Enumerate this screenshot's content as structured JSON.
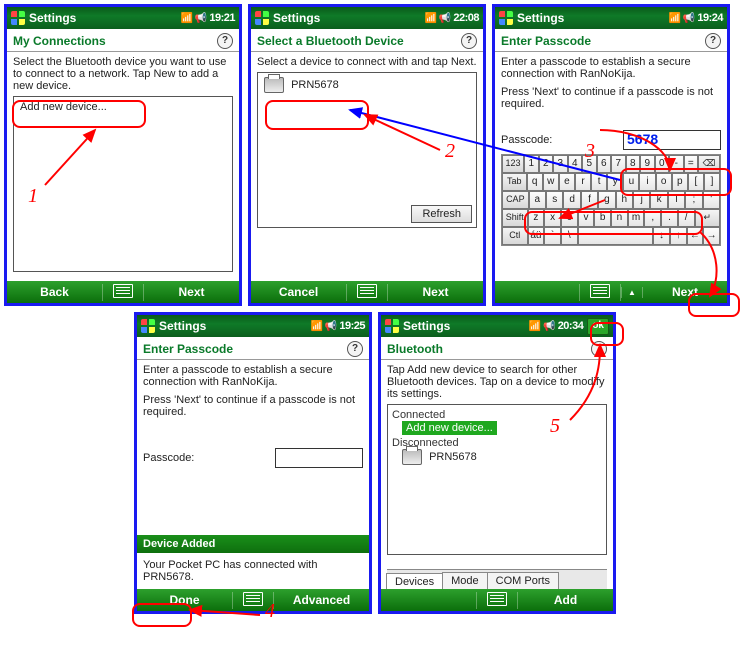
{
  "panel1": {
    "title": "Settings",
    "clock": "19:21",
    "subheader": "My Connections",
    "instructions": "Select the Bluetooth device you want to use to connect to a network. Tap New to add a new device.",
    "add_new": "Add new device...",
    "soft_left": "Back",
    "soft_right": "Next"
  },
  "panel2": {
    "title": "Settings",
    "clock": "22:08",
    "subheader": "Select a Bluetooth Device",
    "instructions": "Select a device to connect with and tap Next.",
    "device": "PRN5678",
    "refresh": "Refresh",
    "soft_left": "Cancel",
    "soft_right": "Next"
  },
  "panel3": {
    "title": "Settings",
    "clock": "19:24",
    "subheader": "Enter Passcode",
    "line1": "Enter a passcode to establish a secure connection with RanNoKija.",
    "line2": "Press 'Next' to continue if a passcode is not required.",
    "label": "Passcode:",
    "value": "5678",
    "soft_right": "Next",
    "sip_rows": [
      [
        "123",
        "1",
        "2",
        "3",
        "4",
        "5",
        "6",
        "7",
        "8",
        "9",
        "0",
        "-",
        "=",
        "⌫"
      ],
      [
        "Tab",
        "q",
        "w",
        "e",
        "r",
        "t",
        "y",
        "u",
        "i",
        "o",
        "p",
        "[",
        "]"
      ],
      [
        "CAP",
        "a",
        "s",
        "d",
        "f",
        "g",
        "h",
        "j",
        "k",
        "l",
        ";",
        "'"
      ],
      [
        "Shift",
        "z",
        "x",
        "c",
        "v",
        "b",
        "n",
        "m",
        ",",
        ".",
        "/",
        "↵"
      ],
      [
        "Ctl",
        "áü",
        "`",
        "\\",
        " ",
        "↓",
        "↑",
        "←",
        "→"
      ]
    ]
  },
  "panel4": {
    "title": "Settings",
    "clock": "19:25",
    "subheader": "Enter Passcode",
    "line1": "Enter a passcode to establish a secure connection with RanNoKija.",
    "line2": "Press 'Next' to continue if a passcode is not required.",
    "label": "Passcode:",
    "value": "",
    "added_title": "Device Added",
    "added_msg": "Your Pocket PC has connected with PRN5678.",
    "soft_left": "Done",
    "soft_right": "Advanced"
  },
  "panel5": {
    "title": "Settings",
    "clock": "20:34",
    "ok": "ok",
    "subheader": "Bluetooth",
    "instructions": "Tap Add new device to search for other Bluetooth devices. Tap on a device to modify its settings.",
    "connected_label": "Connected",
    "add_new": "Add new device...",
    "disconnected_label": "Disconnected",
    "device": "PRN5678",
    "tabs": [
      "Devices",
      "Mode",
      "COM Ports"
    ],
    "soft_right": "Add"
  },
  "anno": {
    "n1": "1",
    "n2": "2",
    "n3": "3",
    "n4": "4",
    "n5": "5"
  }
}
